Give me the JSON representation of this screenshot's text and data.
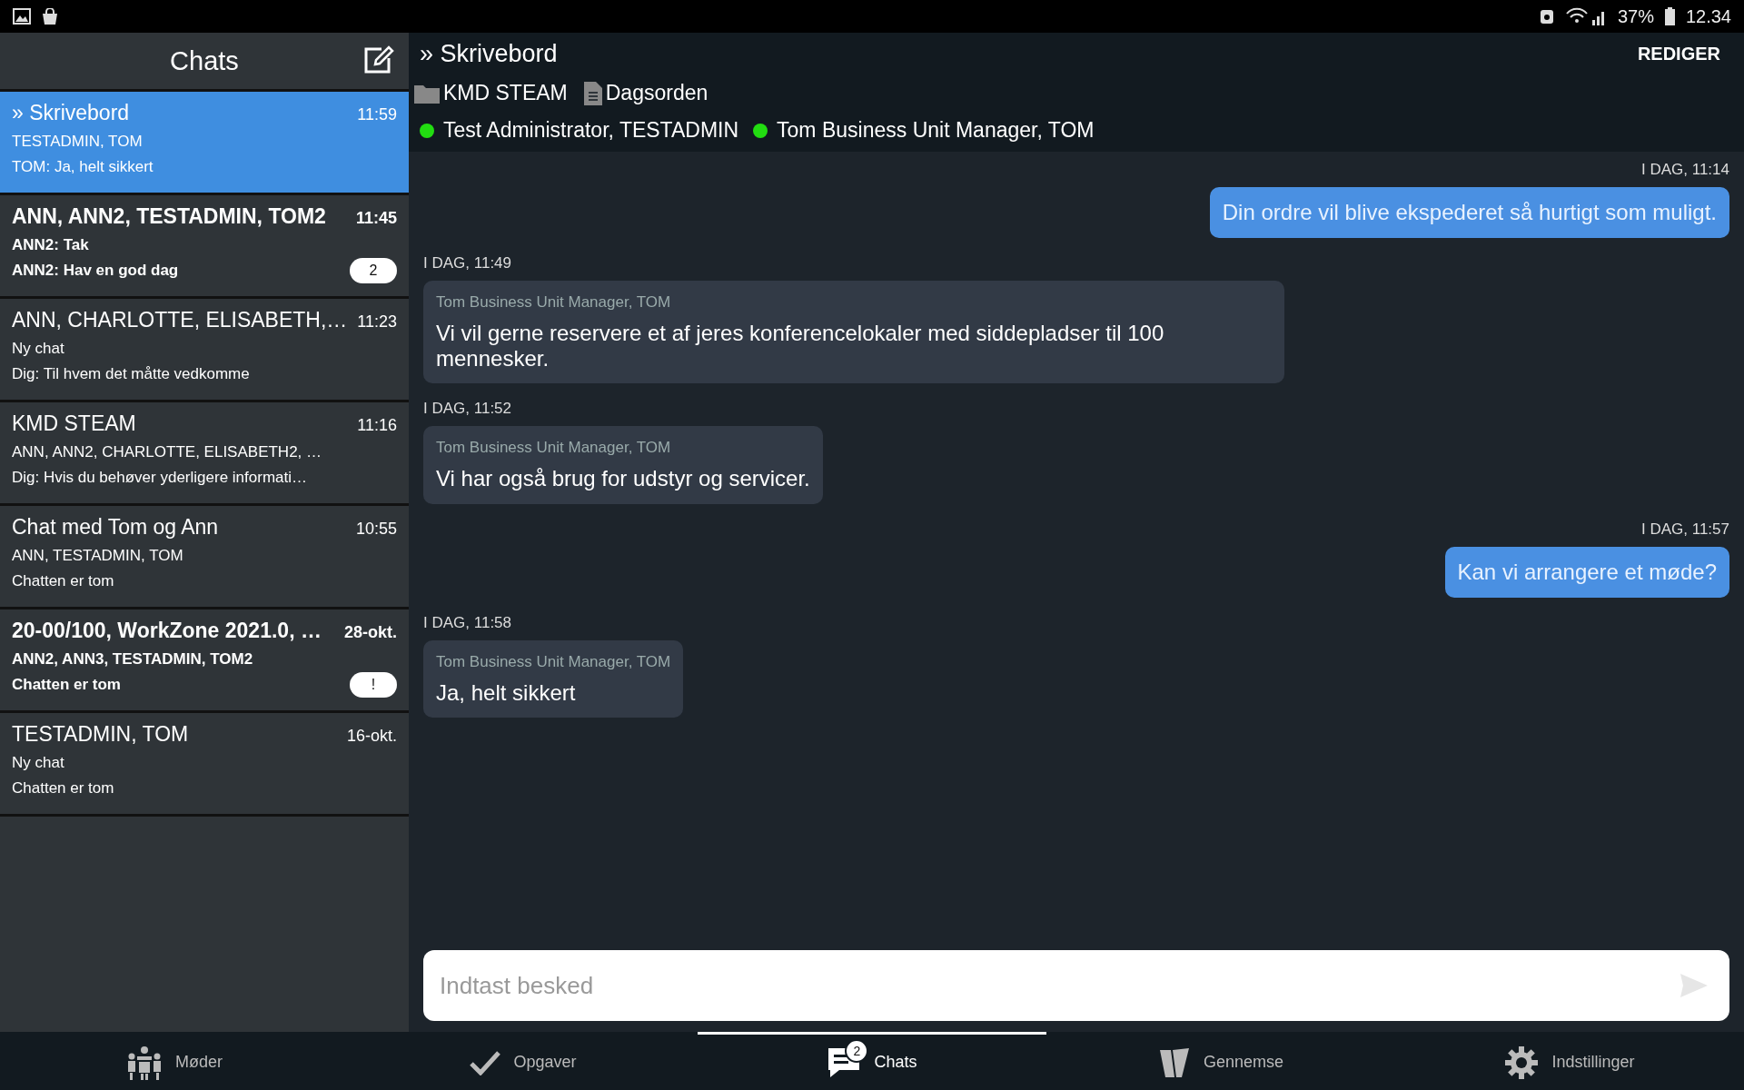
{
  "status_bar": {
    "battery": "37%",
    "time": "12.34"
  },
  "sidebar": {
    "title": "Chats",
    "items": [
      {
        "title": "» Skrivebord",
        "time": "11:59",
        "participants": "TESTADMIN, TOM",
        "last_message": "TOM: Ja, helt sikkert",
        "unread": false,
        "selected": true
      },
      {
        "title": "ANN, ANN2, TESTADMIN, TOM2",
        "time": "11:45",
        "participants": "ANN2: Tak",
        "last_message": "ANN2: Hav en god dag",
        "unread": true,
        "badge": "2",
        "selected": false
      },
      {
        "title": "ANN, CHARLOTTE, ELISABETH,…",
        "time": "11:23",
        "participants": "Ny chat",
        "last_message": "Dig: Til hvem det måtte vedkomme",
        "unread": false,
        "selected": false
      },
      {
        "title": "KMD STEAM",
        "time": "11:16",
        "participants": "ANN, ANN2, CHARLOTTE, ELISABETH2, …",
        "last_message": "Dig: Hvis du behøver yderligere informati…",
        "unread": false,
        "selected": false
      },
      {
        "title": "Chat med Tom og Ann",
        "time": "10:55",
        "participants": "ANN, TESTADMIN, TOM",
        "last_message": "Chatten er tom",
        "unread": false,
        "selected": false
      },
      {
        "title": "20-00/100, WorkZone 2021.0, …",
        "time": "28-okt.",
        "participants": "ANN2, ANN3, TESTADMIN, TOM2",
        "last_message": "Chatten er tom",
        "unread": true,
        "badge": "!",
        "selected": false
      },
      {
        "title": "TESTADMIN, TOM",
        "time": "16-okt.",
        "participants": "Ny chat",
        "last_message": "Chatten er tom",
        "unread": false,
        "selected": false
      }
    ]
  },
  "conversation": {
    "title": "» Skrivebord",
    "edit_button": "REDIGER",
    "attachments": [
      {
        "kind": "folder",
        "label": "KMD STEAM"
      },
      {
        "kind": "document",
        "label": "Dagsorden"
      }
    ],
    "participants": [
      {
        "name": "Test Administrator, TESTADMIN",
        "online": true
      },
      {
        "name": "Tom Business Unit Manager, TOM",
        "online": true
      }
    ],
    "messages": [
      {
        "kind": "outgoing",
        "timestamp": "I DAG, 11:14",
        "text": "Din ordre vil blive ekspederet så hurtigt som muligt."
      },
      {
        "kind": "incoming",
        "timestamp": "I DAG, 11:49",
        "sender": "Tom Business Unit Manager, TOM",
        "text": "Vi vil gerne reservere et af jeres konferencelokaler med siddepladser til 100 mennesker."
      },
      {
        "kind": "incoming",
        "timestamp": "I DAG, 11:52",
        "sender": "Tom Business Unit Manager, TOM",
        "text": "Vi har også brug for udstyr og servicer."
      },
      {
        "kind": "outgoing",
        "timestamp": "I DAG, 11:57",
        "text": "Kan vi arrangere et møde?"
      },
      {
        "kind": "incoming",
        "timestamp": "I DAG, 11:58",
        "sender": "Tom Business Unit Manager, TOM",
        "text": "Ja, helt sikkert"
      }
    ],
    "input": {
      "placeholder": "Indtast besked"
    }
  },
  "bottom_nav": [
    {
      "kind": "meetings",
      "label": "Møder",
      "selected": false
    },
    {
      "kind": "tasks",
      "label": "Opgaver",
      "selected": false
    },
    {
      "kind": "chats",
      "label": "Chats",
      "badge": "2",
      "selected": true
    },
    {
      "kind": "review",
      "label": "Gennemse",
      "selected": false
    },
    {
      "kind": "settings",
      "label": "Indstillinger",
      "selected": false
    }
  ]
}
